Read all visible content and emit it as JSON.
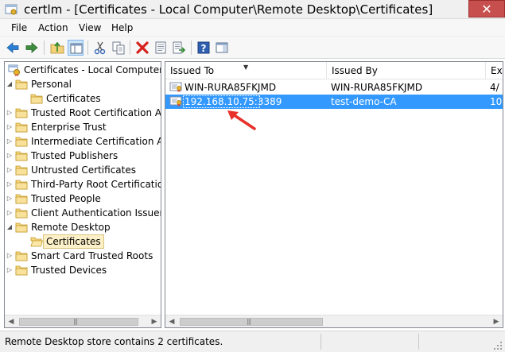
{
  "window": {
    "title": "certlm - [Certificates - Local Computer\\Remote Desktop\\Certificates]",
    "close_glyph": "✕"
  },
  "menu": {
    "items": [
      "File",
      "Action",
      "View",
      "Help"
    ]
  },
  "toolbar": {
    "buttons": [
      "back-arrow-icon",
      "forward-arrow-icon",
      "up-folder-icon",
      "show-hide-tree-icon",
      "cut-icon",
      "copy-icon",
      "delete-icon",
      "properties-icon",
      "export-list-icon",
      "help-icon",
      "console-pane-icon"
    ]
  },
  "tree": {
    "items": [
      {
        "label": "Certificates - Local Computer",
        "level": 0,
        "expander": "",
        "icon": "computer-certificates-icon"
      },
      {
        "label": "Personal",
        "level": 1,
        "expander": "◢",
        "icon": "folder-icon"
      },
      {
        "label": "Certificates",
        "level": 2,
        "expander": "",
        "icon": "folder-icon"
      },
      {
        "label": "Trusted Root Certification Au",
        "level": 1,
        "expander": "▷",
        "icon": "folder-icon"
      },
      {
        "label": "Enterprise Trust",
        "level": 1,
        "expander": "▷",
        "icon": "folder-icon"
      },
      {
        "label": "Intermediate Certification Au",
        "level": 1,
        "expander": "▷",
        "icon": "folder-icon"
      },
      {
        "label": "Trusted Publishers",
        "level": 1,
        "expander": "▷",
        "icon": "folder-icon"
      },
      {
        "label": "Untrusted Certificates",
        "level": 1,
        "expander": "▷",
        "icon": "folder-icon"
      },
      {
        "label": "Third-Party Root Certification",
        "level": 1,
        "expander": "▷",
        "icon": "folder-icon"
      },
      {
        "label": "Trusted People",
        "level": 1,
        "expander": "▷",
        "icon": "folder-icon"
      },
      {
        "label": "Client Authentication Issuers",
        "level": 1,
        "expander": "▷",
        "icon": "folder-icon"
      },
      {
        "label": "Remote Desktop",
        "level": 1,
        "expander": "◢",
        "icon": "folder-icon"
      },
      {
        "label": "Certificates",
        "level": 2,
        "expander": "",
        "icon": "open-folder-icon",
        "selected": true
      },
      {
        "label": "Smart Card Trusted Roots",
        "level": 1,
        "expander": "▷",
        "icon": "folder-icon"
      },
      {
        "label": "Trusted Devices",
        "level": 1,
        "expander": "▷",
        "icon": "folder-icon"
      }
    ]
  },
  "list": {
    "columns": [
      "Issued To",
      "Issued By",
      "Ex"
    ],
    "rows": [
      {
        "issued_to": "WIN-RURA85FKJMD",
        "issued_by": "WIN-RURA85FKJMD",
        "expires": "4/",
        "icon": "certificate-icon",
        "selected": false
      },
      {
        "issued_to": "192.168.10.75:3389",
        "issued_by": "test-demo-CA",
        "expires": "10",
        "icon": "certificate-icon",
        "selected": true
      }
    ]
  },
  "status": {
    "text": "Remote Desktop store contains 2 certificates."
  },
  "colors": {
    "selection": "#3399ff",
    "tree_selection": "#fcf0c8",
    "close": "#c7504f",
    "annotation_arrow": "#e8312a"
  }
}
